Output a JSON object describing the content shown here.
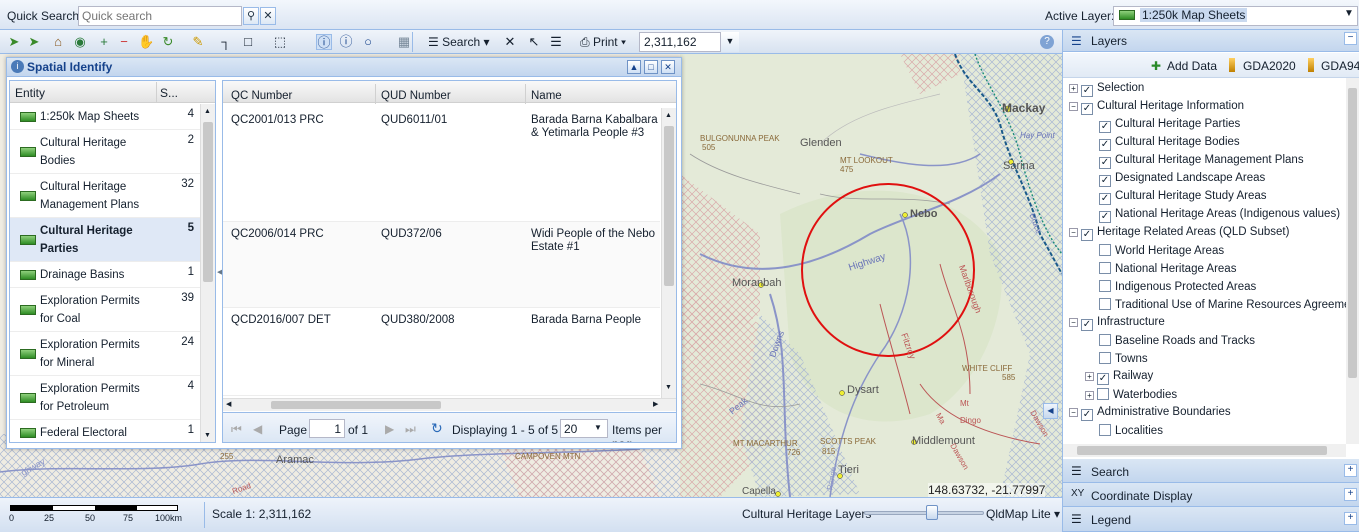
{
  "topbar": {
    "quick_search_label": "Quick Search:",
    "quick_search_placeholder": "Quick search",
    "active_layer_label": "Active Layer:",
    "active_layer_value": "1:250k Map Sheets"
  },
  "toolbar": {
    "search_label": "Search",
    "print_label": "Print",
    "scale_value": "2,311,162"
  },
  "identify": {
    "title": "Spatial Identify",
    "entity_headers": [
      "Entity",
      "S..."
    ],
    "entities": [
      {
        "name": "1:250k Map Sheets",
        "count": "4"
      },
      {
        "name": "Cultural Heritage Bodies",
        "count": "2"
      },
      {
        "name": "Cultural Heritage Management Plans",
        "count": "32"
      },
      {
        "name": "Cultural Heritage Parties",
        "count": "5",
        "selected": true
      },
      {
        "name": "Drainage Basins",
        "count": "1"
      },
      {
        "name": "Exploration Permits for Coal",
        "count": "39"
      },
      {
        "name": "Exploration Permits for Mineral",
        "count": "24"
      },
      {
        "name": "Exploration Permits for Petroleum",
        "count": "4"
      },
      {
        "name": "Federal Electoral",
        "count": "1"
      }
    ],
    "result_headers": [
      "QC Number",
      "QUD Number",
      "Name"
    ],
    "results": [
      {
        "qc": "QC2001/013 PRC",
        "qud": "QUD6011/01",
        "name": "Barada Barna Kabalbara & Yetimarla People #3"
      },
      {
        "qc": "QC2006/014 PRC",
        "qud": "QUD372/06",
        "name": "Widi People of the Nebo Estate #1"
      },
      {
        "qc": "QCD2016/007 DET",
        "qud": "QUD380/2008",
        "name": "Barada Barna People"
      }
    ],
    "pager": {
      "page_label": "Page",
      "page_value": "1",
      "of_label": "of 1",
      "displaying": "Displaying 1 - 5 of 5",
      "per_page": "20",
      "per_page_label": "Items per pag"
    }
  },
  "map": {
    "labels": [
      {
        "t": "Mackay",
        "k": "town"
      },
      {
        "t": "BULGONUNNA PEAK",
        "k": "peak"
      },
      {
        "t": "505",
        "k": "small"
      },
      {
        "t": "Glenden",
        "k": "town"
      },
      {
        "t": "MT LOOKOUT",
        "k": "peak"
      },
      {
        "t": "475",
        "k": "small"
      },
      {
        "t": "Nebo",
        "k": "town"
      },
      {
        "t": "Highway",
        "k": "road"
      },
      {
        "t": "Moranbah",
        "k": "town"
      },
      {
        "t": "Marlborough",
        "k": "road"
      },
      {
        "t": "Fitzroy",
        "k": "road"
      },
      {
        "t": "Peak",
        "k": "road"
      },
      {
        "t": "Downs",
        "k": "road"
      },
      {
        "t": "Dysart",
        "k": "town"
      },
      {
        "t": "WHITE CLIFF",
        "k": "peak"
      },
      {
        "t": "585",
        "k": "small"
      },
      {
        "t": "MT MACARTHUR",
        "k": "peak"
      },
      {
        "t": "726",
        "k": "small"
      },
      {
        "t": "SCOTTS PEAK",
        "k": "peak"
      },
      {
        "t": "815",
        "k": "small"
      },
      {
        "t": "Middlemount",
        "k": "town"
      },
      {
        "t": "Tieri",
        "k": "town"
      },
      {
        "t": "Aramac",
        "k": "town"
      },
      {
        "t": "CAMPOVEN MTN",
        "k": "peak"
      },
      {
        "t": "Capella",
        "k": "town"
      },
      {
        "t": "Road",
        "k": "road"
      },
      {
        "t": "Bruce",
        "k": "road"
      },
      {
        "t": "Hay Point",
        "k": "road"
      },
      {
        "t": "Sarina",
        "k": "town"
      },
      {
        "t": "Dawson",
        "k": "road"
      },
      {
        "t": "Dingo",
        "k": "road"
      },
      {
        "t": "Range",
        "k": "road"
      },
      {
        "t": "255",
        "k": "small"
      },
      {
        "t": "ghway",
        "k": "road"
      },
      {
        "t": "Dawson",
        "k": "road"
      },
      {
        "t": "Ma",
        "k": "road"
      },
      {
        "t": "Mt",
        "k": "road"
      }
    ],
    "coords": "148.63732, -21.77997"
  },
  "right": {
    "layers_title": "Layers",
    "add_data": "Add Data",
    "gda2020": "GDA2020",
    "gda94": "GDA94",
    "tree": [
      {
        "label": "Selection",
        "level": 0,
        "checked": true,
        "expand": true
      },
      {
        "label": "Cultural Heritage Information",
        "level": 0,
        "checked": true,
        "expand": true
      },
      {
        "label": "Cultural Heritage Parties",
        "level": 1,
        "checked": true
      },
      {
        "label": "Cultural Heritage Bodies",
        "level": 1,
        "checked": true
      },
      {
        "label": "Cultural Heritage Management Plans",
        "level": 1,
        "checked": true
      },
      {
        "label": "Designated Landscape Areas",
        "level": 1,
        "checked": true
      },
      {
        "label": "Cultural Heritage Study Areas",
        "level": 1,
        "checked": true
      },
      {
        "label": "National Heritage Areas (Indigenous values)",
        "level": 1,
        "checked": true
      },
      {
        "label": "Heritage Related Areas (QLD Subset)",
        "level": 0,
        "checked": true,
        "expand": true
      },
      {
        "label": "World Heritage Areas",
        "level": 1,
        "checked": false
      },
      {
        "label": "National Heritage Areas",
        "level": 1,
        "checked": false
      },
      {
        "label": "Indigenous Protected Areas",
        "level": 1,
        "checked": false
      },
      {
        "label": "Traditional Use of Marine Resources Agreement",
        "level": 1,
        "checked": false
      },
      {
        "label": "Infrastructure",
        "level": 0,
        "checked": true,
        "expand": true
      },
      {
        "label": "Baseline Roads and Tracks",
        "level": 1,
        "checked": false
      },
      {
        "label": "Towns",
        "level": 1,
        "checked": false
      },
      {
        "label": "Railway",
        "level": 1,
        "checked": true,
        "expand": true
      },
      {
        "label": "Waterbodies",
        "level": 1,
        "checked": false,
        "expand": true
      },
      {
        "label": "Administrative Boundaries",
        "level": 0,
        "checked": true,
        "expand": true
      },
      {
        "label": "Localities",
        "level": 1,
        "checked": false
      }
    ],
    "search_title": "Search",
    "coord_title": "Coordinate Display",
    "legend_title": "Legend"
  },
  "status": {
    "scale_text": "Scale 1: 2,311,162",
    "scalebar_ticks": [
      "0",
      "25",
      "50",
      "75",
      "100km"
    ],
    "layer_label": "Cultural Heritage Layers",
    "basemap": "QldMap Lite"
  }
}
